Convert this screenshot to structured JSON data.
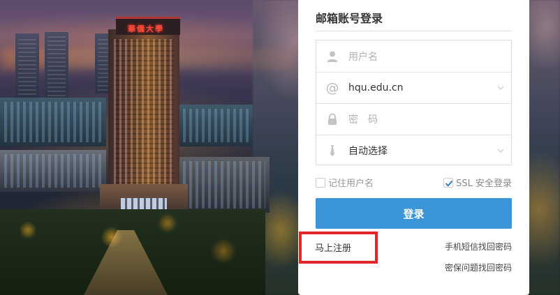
{
  "background": {
    "building_sign": "華僑大學"
  },
  "login": {
    "title": "邮箱账号登录",
    "username_placeholder": "用户名",
    "domain_value": "hqu.edu.cn",
    "password_placeholder": "密　码",
    "mode_value": "自动选择",
    "remember_label": "记住用户名",
    "remember_checked": false,
    "ssl_label": "SSL 安全登录",
    "ssl_checked": true,
    "submit_label": "登录"
  },
  "links": {
    "register": "马上注册",
    "recover_by_sms": "手机短信找回密码",
    "recover_by_question": "密保问题找回密码"
  },
  "colors": {
    "primary_button": "#3b95d6",
    "checkbox_check": "#2a7fc2",
    "highlight_box": "#e0282a",
    "panel_bg": "#ffffff"
  },
  "icons": {
    "username": "user-icon",
    "domain": "at-sign-icon",
    "password": "lock-icon",
    "mode": "tie-icon",
    "dropdown": "chevron-down-icon",
    "ssl_check": "check-icon"
  }
}
